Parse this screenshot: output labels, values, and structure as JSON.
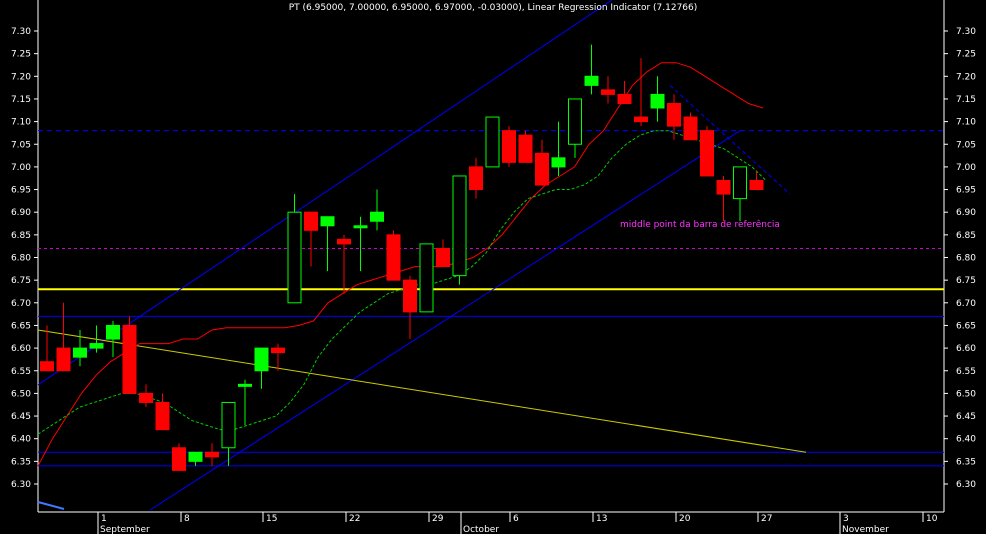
{
  "header": {
    "title": "PT (6.95000, 7.00000, 6.95000, 6.97000, -0.03000), Linear Regression Indicator (7.12766)"
  },
  "annotation": {
    "text": "middle point da barra de referência"
  },
  "colors": {
    "background": "#000000",
    "up_candle": "#00ff00",
    "down_candle": "#ff0000",
    "ma_red": "#ff0000",
    "ma_green_dashed": "#00cc00",
    "channel_blue": "#0000ff",
    "horizontal_blue": "#0000ff",
    "yellow_level": "#ffff00",
    "yellow_trend": "#cccc00",
    "magenta_level": "#cc00cc",
    "axis_text": "#ffffff"
  },
  "chart_data": {
    "type": "candlestick",
    "y_axis": {
      "min": 6.25,
      "max": 7.35,
      "ticks": [
        "7.30",
        "7.25",
        "7.20",
        "7.15",
        "7.10",
        "7.05",
        "7.00",
        "6.95",
        "6.90",
        "6.85",
        "6.80",
        "6.75",
        "6.70",
        "6.65",
        "6.60",
        "6.55",
        "6.50",
        "6.45",
        "6.40",
        "6.35",
        "6.30"
      ]
    },
    "x_axis": {
      "day_ticks": [
        "1",
        "8",
        "15",
        "22",
        "29",
        "6",
        "13",
        "20",
        "27",
        "3",
        "10"
      ],
      "month_labels": [
        "September",
        "October",
        "November"
      ]
    },
    "candles": [
      {
        "o": 6.57,
        "h": 6.65,
        "l": 6.55,
        "c": 6.55
      },
      {
        "o": 6.6,
        "h": 6.7,
        "l": 6.55,
        "c": 6.55
      },
      {
        "o": 6.58,
        "h": 6.64,
        "l": 6.56,
        "c": 6.6
      },
      {
        "o": 6.6,
        "h": 6.65,
        "l": 6.59,
        "c": 6.61
      },
      {
        "o": 6.62,
        "h": 6.66,
        "l": 6.58,
        "c": 6.65
      },
      {
        "o": 6.65,
        "h": 6.67,
        "l": 6.5,
        "c": 6.5
      },
      {
        "o": 6.5,
        "h": 6.52,
        "l": 6.47,
        "c": 6.48
      },
      {
        "o": 6.48,
        "h": 6.5,
        "l": 6.42,
        "c": 6.42
      },
      {
        "o": 6.38,
        "h": 6.39,
        "l": 6.33,
        "c": 6.33
      },
      {
        "o": 6.35,
        "h": 6.37,
        "l": 6.34,
        "c": 6.37
      },
      {
        "o": 6.37,
        "h": 6.39,
        "l": 6.34,
        "c": 6.36
      },
      {
        "o": 6.38,
        "h": 6.48,
        "l": 6.34,
        "c": 6.48
      },
      {
        "o": 6.52,
        "h": 6.53,
        "l": 6.43,
        "c": 6.52
      },
      {
        "o": 6.55,
        "h": 6.6,
        "l": 6.51,
        "c": 6.6
      },
      {
        "o": 6.6,
        "h": 6.61,
        "l": 6.55,
        "c": 6.59
      },
      {
        "o": 6.7,
        "h": 6.94,
        "l": 6.7,
        "c": 6.9
      },
      {
        "o": 6.9,
        "h": 6.9,
        "l": 6.78,
        "c": 6.86
      },
      {
        "o": 6.87,
        "h": 6.89,
        "l": 6.77,
        "c": 6.89
      },
      {
        "o": 6.84,
        "h": 6.85,
        "l": 6.72,
        "c": 6.83
      },
      {
        "o": 6.87,
        "h": 6.89,
        "l": 6.77,
        "c": 6.87
      },
      {
        "o": 6.88,
        "h": 6.95,
        "l": 6.86,
        "c": 6.9
      },
      {
        "o": 6.85,
        "h": 6.86,
        "l": 6.75,
        "c": 6.75
      },
      {
        "o": 6.75,
        "h": 6.76,
        "l": 6.62,
        "c": 6.68
      },
      {
        "o": 6.68,
        "h": 6.83,
        "l": 6.68,
        "c": 6.83
      },
      {
        "o": 6.82,
        "h": 6.84,
        "l": 6.78,
        "c": 6.78
      },
      {
        "o": 6.76,
        "h": 6.98,
        "l": 6.74,
        "c": 6.98
      },
      {
        "o": 7.0,
        "h": 7.02,
        "l": 6.93,
        "c": 6.95
      },
      {
        "o": 7.0,
        "h": 7.11,
        "l": 7.0,
        "c": 7.11
      },
      {
        "o": 7.08,
        "h": 7.09,
        "l": 7.0,
        "c": 7.01
      },
      {
        "o": 7.07,
        "h": 7.08,
        "l": 7.01,
        "c": 7.01
      },
      {
        "o": 7.03,
        "h": 7.06,
        "l": 6.96,
        "c": 6.96
      },
      {
        "o": 7.0,
        "h": 7.1,
        "l": 6.98,
        "c": 7.02
      },
      {
        "o": 7.05,
        "h": 7.15,
        "l": 7.02,
        "c": 7.15
      },
      {
        "o": 7.18,
        "h": 7.27,
        "l": 7.16,
        "c": 7.2
      },
      {
        "o": 7.17,
        "h": 7.2,
        "l": 7.14,
        "c": 7.16
      },
      {
        "o": 7.16,
        "h": 7.19,
        "l": 7.14,
        "c": 7.14
      },
      {
        "o": 7.11,
        "h": 7.24,
        "l": 7.09,
        "c": 7.1
      },
      {
        "o": 7.13,
        "h": 7.2,
        "l": 7.1,
        "c": 7.16
      },
      {
        "o": 7.14,
        "h": 7.16,
        "l": 7.06,
        "c": 7.09
      },
      {
        "o": 7.11,
        "h": 7.12,
        "l": 7.06,
        "c": 7.06
      },
      {
        "o": 7.08,
        "h": 7.09,
        "l": 6.98,
        "c": 6.98
      },
      {
        "o": 6.97,
        "h": 6.98,
        "l": 6.88,
        "c": 6.94
      },
      {
        "o": 6.93,
        "h": 7.0,
        "l": 6.88,
        "c": 7.0
      },
      {
        "o": 6.97,
        "h": 6.99,
        "l": 6.95,
        "c": 6.95
      }
    ],
    "red_ma": [
      6.34,
      6.4,
      6.45,
      6.5,
      6.54,
      6.57,
      6.59,
      6.61,
      6.61,
      6.61,
      6.62,
      6.62,
      6.64,
      6.645,
      6.645,
      6.645,
      6.645,
      6.645,
      6.65,
      6.66,
      6.7,
      6.72,
      6.74,
      6.75,
      6.76,
      6.77,
      6.78,
      6.78,
      6.78,
      6.79,
      6.8,
      6.82,
      6.85,
      6.89,
      6.93,
      6.96,
      6.98,
      7.0,
      7.05,
      7.08,
      7.13,
      7.18,
      7.21,
      7.23,
      7.23,
      7.22,
      7.2,
      7.18,
      7.16,
      7.14,
      7.13
    ],
    "green_ma": [
      6.41,
      6.43,
      6.45,
      6.47,
      6.48,
      6.49,
      6.5,
      6.5,
      6.49,
      6.48,
      6.46,
      6.44,
      6.43,
      6.42,
      6.42,
      6.43,
      6.44,
      6.45,
      6.48,
      6.52,
      6.58,
      6.62,
      6.65,
      6.68,
      6.7,
      6.72,
      6.73,
      6.74,
      6.74,
      6.75,
      6.76,
      6.78,
      6.81,
      6.86,
      6.9,
      6.93,
      6.94,
      6.95,
      6.95,
      6.96,
      6.98,
      7.02,
      7.05,
      7.07,
      7.08,
      7.08,
      7.07,
      7.06,
      7.05,
      7.04,
      7.02,
      7.0,
      6.97
    ],
    "horizontal_levels": {
      "magenta_dashed": 6.82,
      "yellow_solid": 6.73,
      "blue_solid": [
        6.67,
        6.37,
        6.34
      ],
      "blue_dashed": 7.08
    }
  }
}
